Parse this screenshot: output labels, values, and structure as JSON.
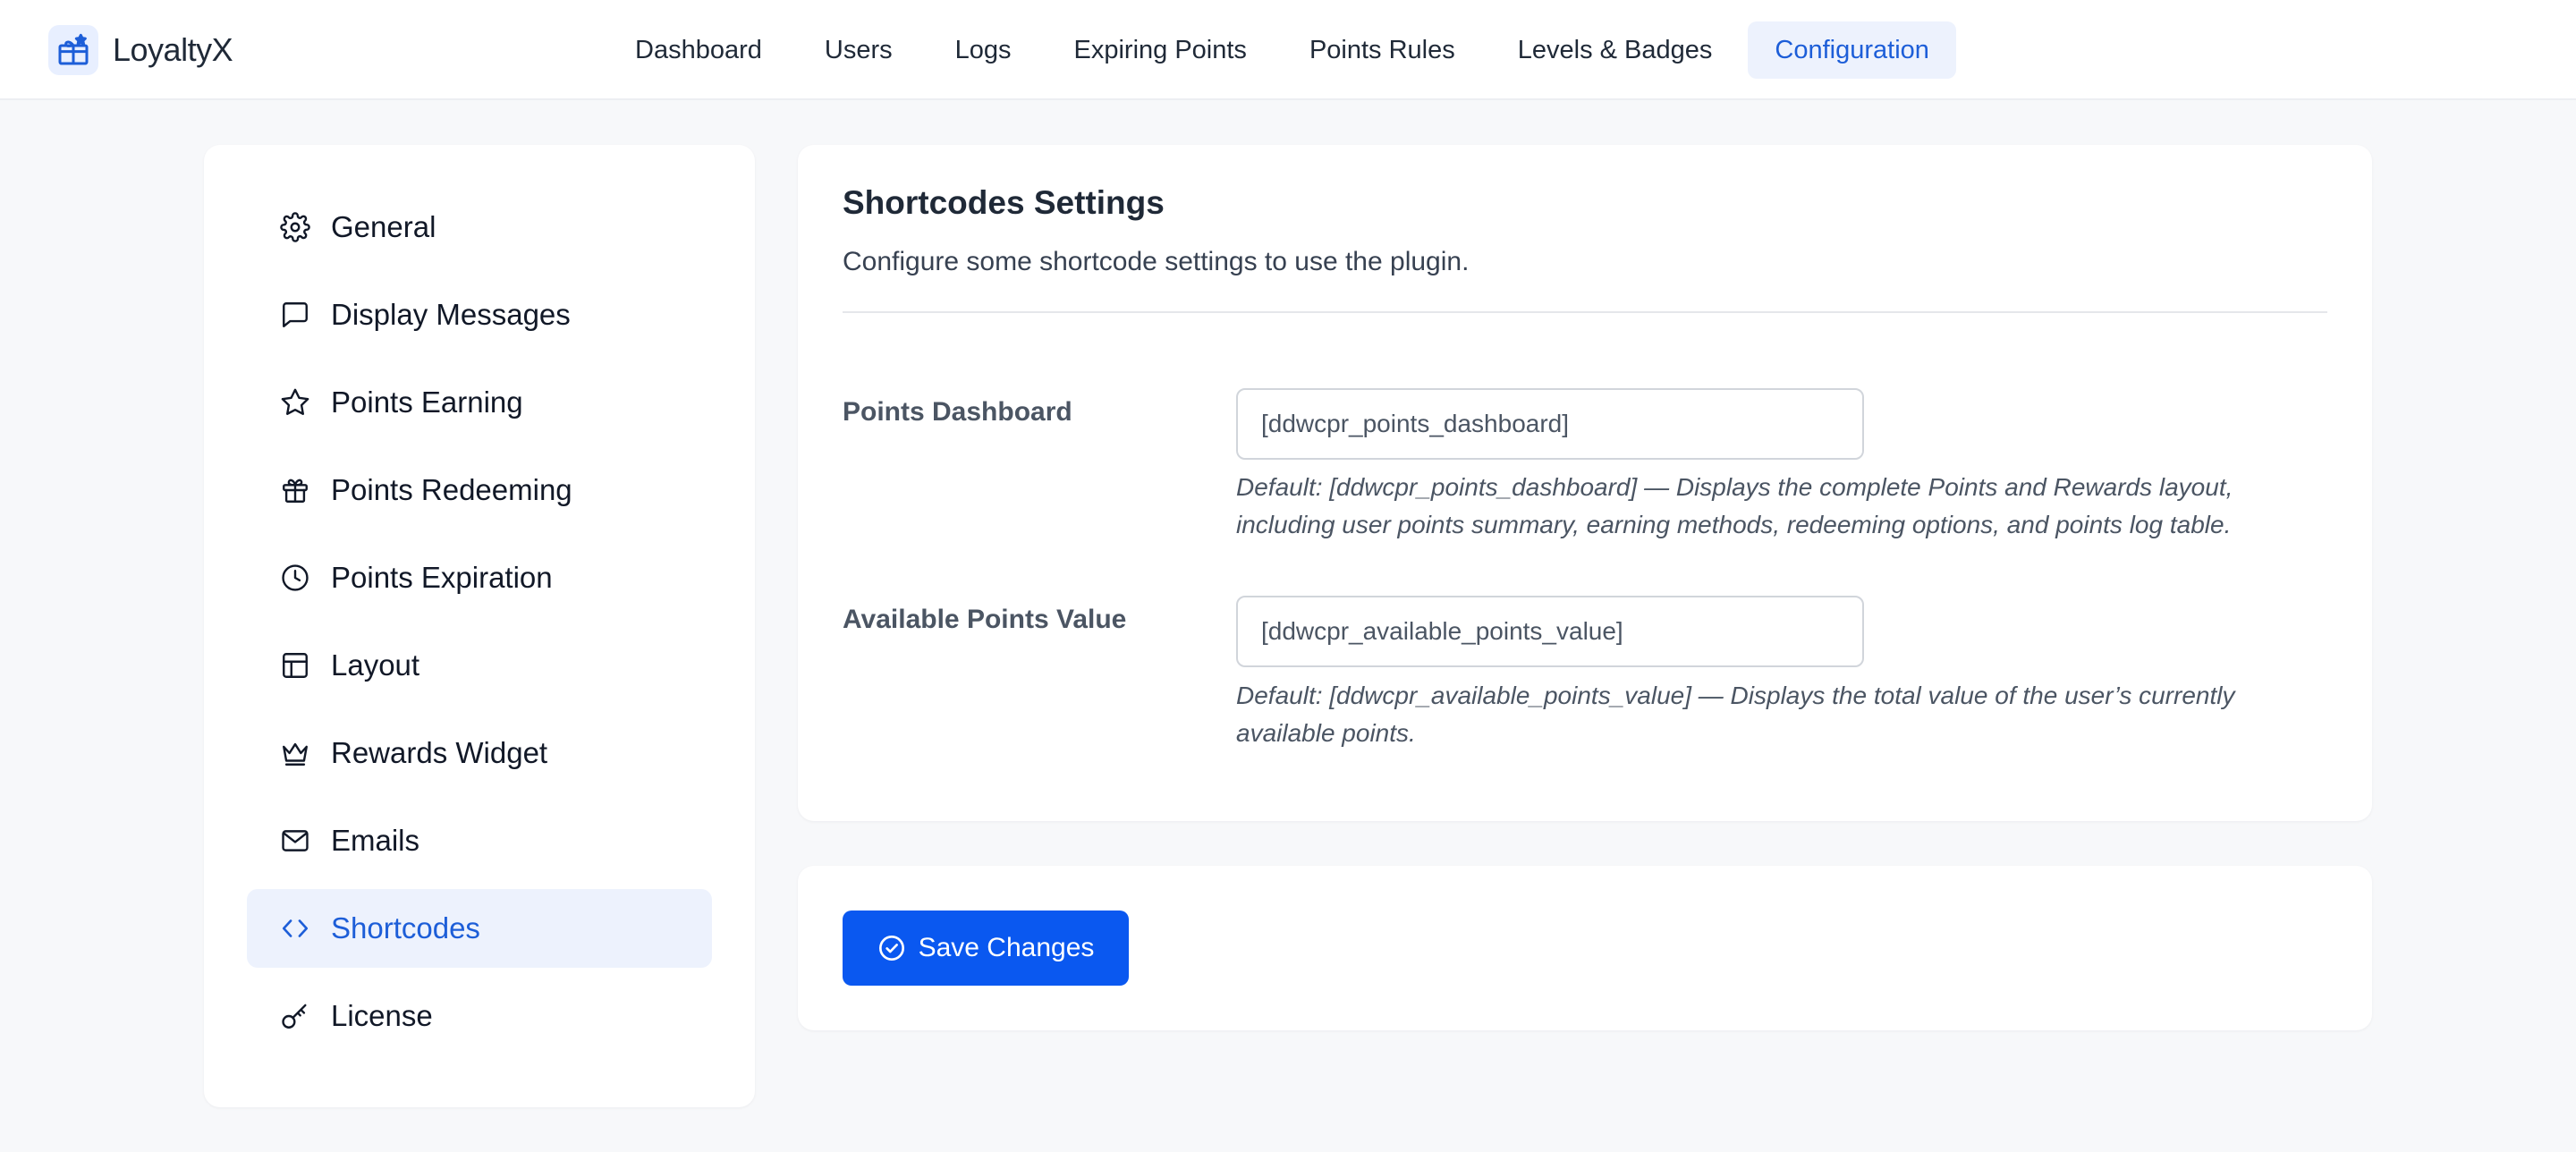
{
  "app": {
    "name": "LoyaltyX",
    "logo_icon": "gift-icon",
    "accent_color": "#1d5ed8",
    "button_color": "#0a58f0"
  },
  "nav": {
    "items": [
      {
        "label": "Dashboard",
        "active": false
      },
      {
        "label": "Users",
        "active": false
      },
      {
        "label": "Logs",
        "active": false
      },
      {
        "label": "Expiring Points",
        "active": false
      },
      {
        "label": "Points Rules",
        "active": false
      },
      {
        "label": "Levels & Badges",
        "active": false
      },
      {
        "label": "Configuration",
        "active": true
      }
    ]
  },
  "sidebar": {
    "items": [
      {
        "label": "General",
        "icon": "gear-icon"
      },
      {
        "label": "Display Messages",
        "icon": "message-icon"
      },
      {
        "label": "Points Earning",
        "icon": "star-icon"
      },
      {
        "label": "Points Redeeming",
        "icon": "gift-icon"
      },
      {
        "label": "Points Expiration",
        "icon": "clock-icon"
      },
      {
        "label": "Layout",
        "icon": "layout-icon"
      },
      {
        "label": "Rewards Widget",
        "icon": "crown-icon"
      },
      {
        "label": "Emails",
        "icon": "mail-icon"
      },
      {
        "label": "Shortcodes",
        "icon": "code-icon",
        "active": true
      },
      {
        "label": "License",
        "icon": "key-icon"
      }
    ]
  },
  "main": {
    "title": "Shortcodes Settings",
    "description": "Configure some shortcode settings to use the plugin.",
    "fields": [
      {
        "label": "Points Dashboard",
        "value": "[ddwcpr_points_dashboard]",
        "help_line1": "Default: [ddwcpr_points_dashboard] — Displays the complete Points and Rewards layout,",
        "help_line2": "including user points summary, earning methods, redeeming options, and points log table."
      },
      {
        "label": "Available Points Value",
        "value": "[ddwcpr_available_points_value]",
        "help_line1": "Default: [ddwcpr_available_points_value] — Displays the total value of the user’s currently",
        "help_line2": "available points."
      }
    ]
  },
  "actions": {
    "save_label": "Save Changes",
    "save_icon": "check-circle-icon"
  }
}
